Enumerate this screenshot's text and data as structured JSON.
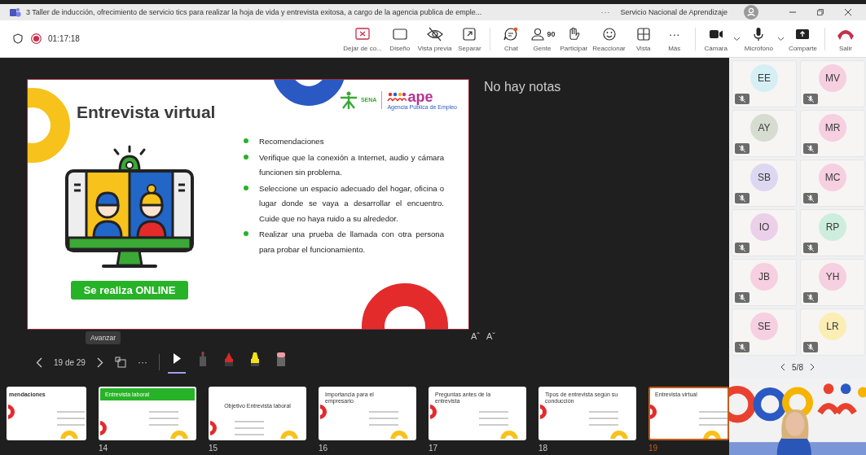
{
  "window": {
    "title": "3 Taller de inducción, ofrecimiento de servicio tics para realizar la hoja de vida y entrevista exitosa, a cargo de la agencia publica de emple...",
    "more": "···",
    "organization": "Servicio Nacional de Aprendizaje"
  },
  "meeting": {
    "elapsed": "01:17:18",
    "recording": true
  },
  "toolbar": [
    {
      "kind": "stop-share",
      "label": "Dejar de co..."
    },
    {
      "kind": "layout",
      "label": "Diseño"
    },
    {
      "kind": "preview",
      "label": "Vista previa"
    },
    {
      "kind": "popout",
      "label": "Separar"
    },
    {
      "kind": "divider"
    },
    {
      "kind": "chat",
      "label": "Chat"
    },
    {
      "kind": "people",
      "label": "Gente",
      "count": "90"
    },
    {
      "kind": "hand",
      "label": "Participar"
    },
    {
      "kind": "react",
      "label": "Reaccionar"
    },
    {
      "kind": "view",
      "label": "Vista"
    },
    {
      "kind": "more",
      "label": "Más",
      "glyph": "···"
    },
    {
      "kind": "divider"
    },
    {
      "kind": "camera",
      "label": "Cámara",
      "dropdown": true
    },
    {
      "kind": "mic",
      "label": "Micrófono",
      "dropdown": true
    },
    {
      "kind": "share",
      "label": "Comparte"
    },
    {
      "kind": "divider"
    },
    {
      "kind": "leave",
      "label": "Salir"
    }
  ],
  "slide": {
    "title": "Entrevista virtual",
    "logo": {
      "sena": "SENA",
      "brand": "ape",
      "tagline": "Agencia Pública de Empleo"
    },
    "bullets": [
      "Recomendaciones",
      "Verifique que la conexión a Internet, audio y cámara funcionen sin problema.",
      "Seleccione un espacio adecuado del hogar, oficina o lugar donde se vaya a desarrollar el encuentro. Cuide que no haya ruido a su alrededor.",
      "Realizar una prueba de llamada con otra persona para probar el funcionamiento."
    ],
    "button": "Se realiza ONLINE"
  },
  "notes": "No hay notas",
  "font_controls": [
    "Aˆ",
    "Aˇ"
  ],
  "tooltip": "Avanzar",
  "navigation": {
    "page": "19 de 29",
    "more": "···"
  },
  "tools": [
    {
      "kind": "pointer",
      "selected": true
    },
    {
      "kind": "pen",
      "selected": false
    },
    {
      "kind": "marker",
      "selected": false
    },
    {
      "kind": "highlighter",
      "selected": false
    },
    {
      "kind": "eraser",
      "selected": false
    }
  ],
  "thumbnails": [
    {
      "title": "mendaciones",
      "kind": "plain",
      "selected": false
    },
    {
      "number": "14",
      "title": "Entrevista laboral",
      "kind": "banner",
      "selected": false
    },
    {
      "number": "15",
      "title": "Objetivo Entrevista laboral",
      "kind": "centered",
      "selected": false
    },
    {
      "number": "16",
      "title": "Importancia para el empresario",
      "kind": "plain",
      "selected": false
    },
    {
      "number": "17",
      "title": "Preguntas antes de la entrevista",
      "kind": "plain",
      "selected": false
    },
    {
      "number": "18",
      "title": "Tipos de entrevista según su conducción",
      "kind": "plain",
      "selected": false
    },
    {
      "number": "19",
      "title": "Entrevista virtual",
      "kind": "plain",
      "selected": true
    }
  ],
  "participants": [
    {
      "initials": "EE",
      "color": "#d6eff4",
      "muted": true
    },
    {
      "initials": "MV",
      "color": "#f6cfe0",
      "muted": true
    },
    {
      "initials": "AY",
      "color": "#d6dcd0",
      "muted": true
    },
    {
      "initials": "MR",
      "color": "#f6cfe0",
      "muted": true
    },
    {
      "initials": "SB",
      "color": "#ddd8f1",
      "muted": true
    },
    {
      "initials": "MC",
      "color": "#f6cfe0",
      "muted": true
    },
    {
      "initials": "IO",
      "color": "#ecd0ea",
      "muted": true
    },
    {
      "initials": "RP",
      "color": "#cdeedd",
      "muted": true
    },
    {
      "initials": "JB",
      "color": "#f6cfe0",
      "muted": true
    },
    {
      "initials": "YH",
      "color": "#f6cfe0",
      "muted": true
    },
    {
      "initials": "SE",
      "color": "#f6cfe0",
      "muted": true
    },
    {
      "initials": "LR",
      "color": "#fbeeb5",
      "muted": true
    }
  ],
  "pager": "5/8"
}
